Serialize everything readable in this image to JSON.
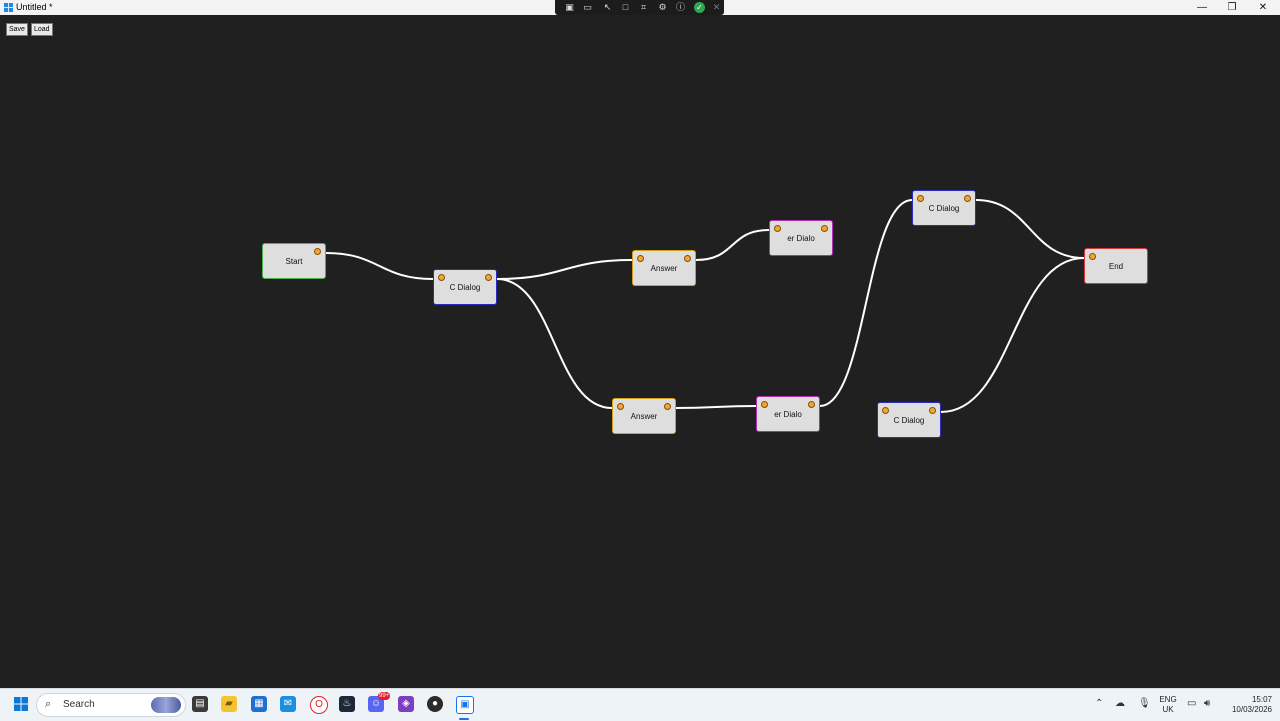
{
  "window": {
    "title": "Untitled *",
    "minimize": "—",
    "restore": "❐",
    "close": "✕"
  },
  "toolbar": {
    "save_label": "Save",
    "load_label": "Load"
  },
  "recorder_bar": {
    "icons": [
      "screenshot-icon",
      "video-icon",
      "pointer-icon",
      "region-icon",
      "crop-icon",
      "settings-icon",
      "accessibility-icon",
      "check-icon",
      "close-icon"
    ]
  },
  "graph": {
    "nodes": [
      {
        "id": "n1",
        "type": "start",
        "label": "Start"
      },
      {
        "id": "n2",
        "type": "npc",
        "label": "C Dialog"
      },
      {
        "id": "n3",
        "type": "answer",
        "label": "Answer"
      },
      {
        "id": "n4",
        "type": "player",
        "label": "er Dialo"
      },
      {
        "id": "n5",
        "type": "answer",
        "label": "Answer"
      },
      {
        "id": "n6",
        "type": "player",
        "label": "er Dialo"
      },
      {
        "id": "n7",
        "type": "npc",
        "label": "C Dialog"
      },
      {
        "id": "n8",
        "type": "npc",
        "label": "C Dialog"
      },
      {
        "id": "n9",
        "type": "end",
        "label": "End"
      }
    ],
    "edges": [
      [
        "n1",
        "n2"
      ],
      [
        "n2",
        "n3"
      ],
      [
        "n2",
        "n5"
      ],
      [
        "n3",
        "n4"
      ],
      [
        "n5",
        "n6"
      ],
      [
        "n6",
        "n7"
      ],
      [
        "n7",
        "n9"
      ],
      [
        "n8",
        "n9"
      ]
    ],
    "colors": {
      "start": "#4caf50",
      "npc": "#2a2dbd",
      "answer": "#d4a017",
      "player": "#b02db5",
      "end": "#d63a3a",
      "port": "#f2a53a",
      "edge": "#ffffff"
    }
  },
  "taskbar": {
    "search_label": "Search",
    "apps": [
      "windows-start-icon",
      "task-view-icon",
      "file-explorer-icon",
      "store-icon",
      "outlook-icon",
      "opera-icon",
      "steam-icon",
      "discord-icon",
      "visual-studio-icon",
      "davinci-icon",
      "active-app-icon"
    ],
    "discord_badge": "99+",
    "language": "ENG",
    "region": "UK",
    "time": "15:07",
    "date": "10/03/2026"
  }
}
